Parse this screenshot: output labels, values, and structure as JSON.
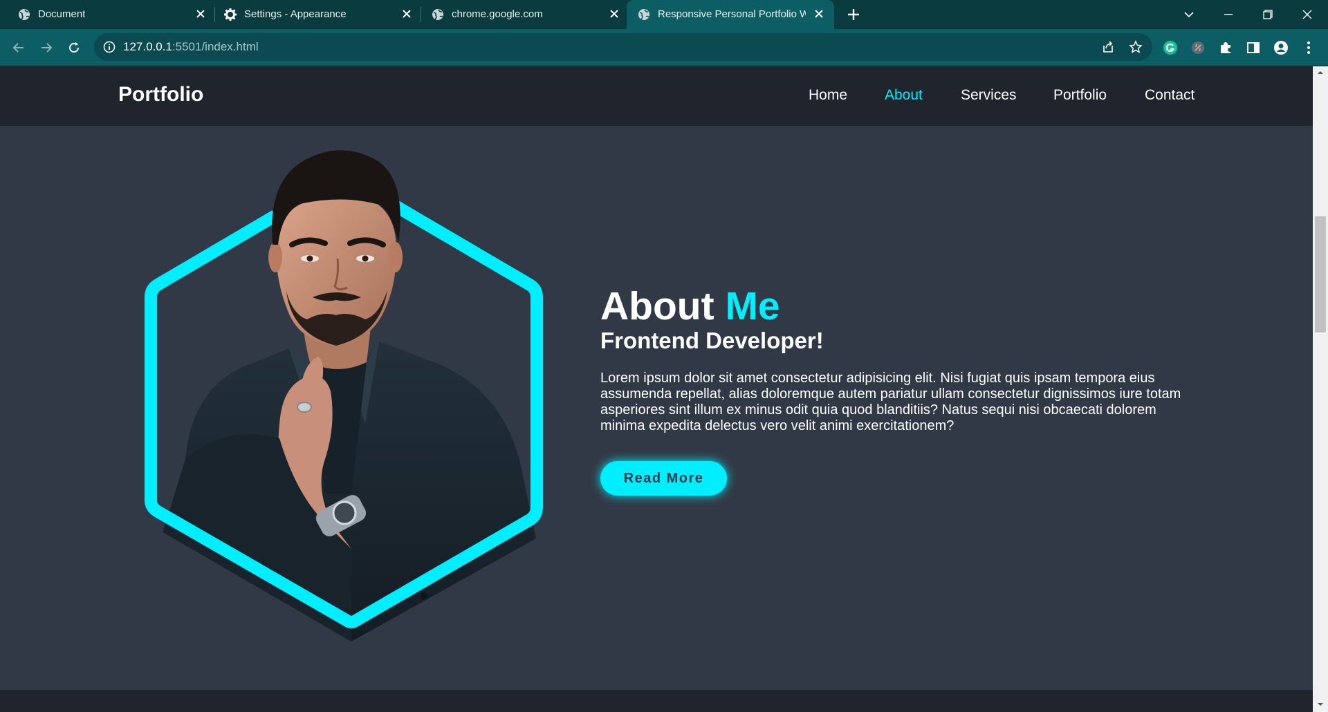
{
  "tabs": [
    {
      "title": "Document",
      "icon": "globe-icon"
    },
    {
      "title": "Settings - Appearance",
      "icon": "gear-icon"
    },
    {
      "title": "chrome.google.com",
      "icon": "globe-icon"
    },
    {
      "title": "Responsive Personal Portfolio W",
      "icon": "globe-icon",
      "active": true
    }
  ],
  "address": {
    "host": "127.0.0.1",
    "rest": ":5501/index.html"
  },
  "site": {
    "logo": "Portfolio",
    "nav": [
      "Home",
      "About",
      "Services",
      "Portfolio",
      "Contact"
    ],
    "active_nav": "About"
  },
  "about": {
    "title_main": "About ",
    "title_accent": "Me",
    "subtitle": "Frontend Developer!",
    "text": "Lorem ipsum dolor sit amet consectetur adipisicing elit. Nisi fugiat quis ipsam tempora eius assumenda repellat, alias doloremque autem pariatur ullam consectetur dignissimos iure totam asperiores sint illum ex minus odit quia quod blanditiis? Natus sequi nisi obcaecati dolorem minima expedita delectus vero velit animi exercitationem?",
    "button": "Read More"
  },
  "colors": {
    "accent": "#00eeff",
    "bg": "#323946",
    "header": "#1f242d",
    "chrome": "#0d5e64"
  }
}
